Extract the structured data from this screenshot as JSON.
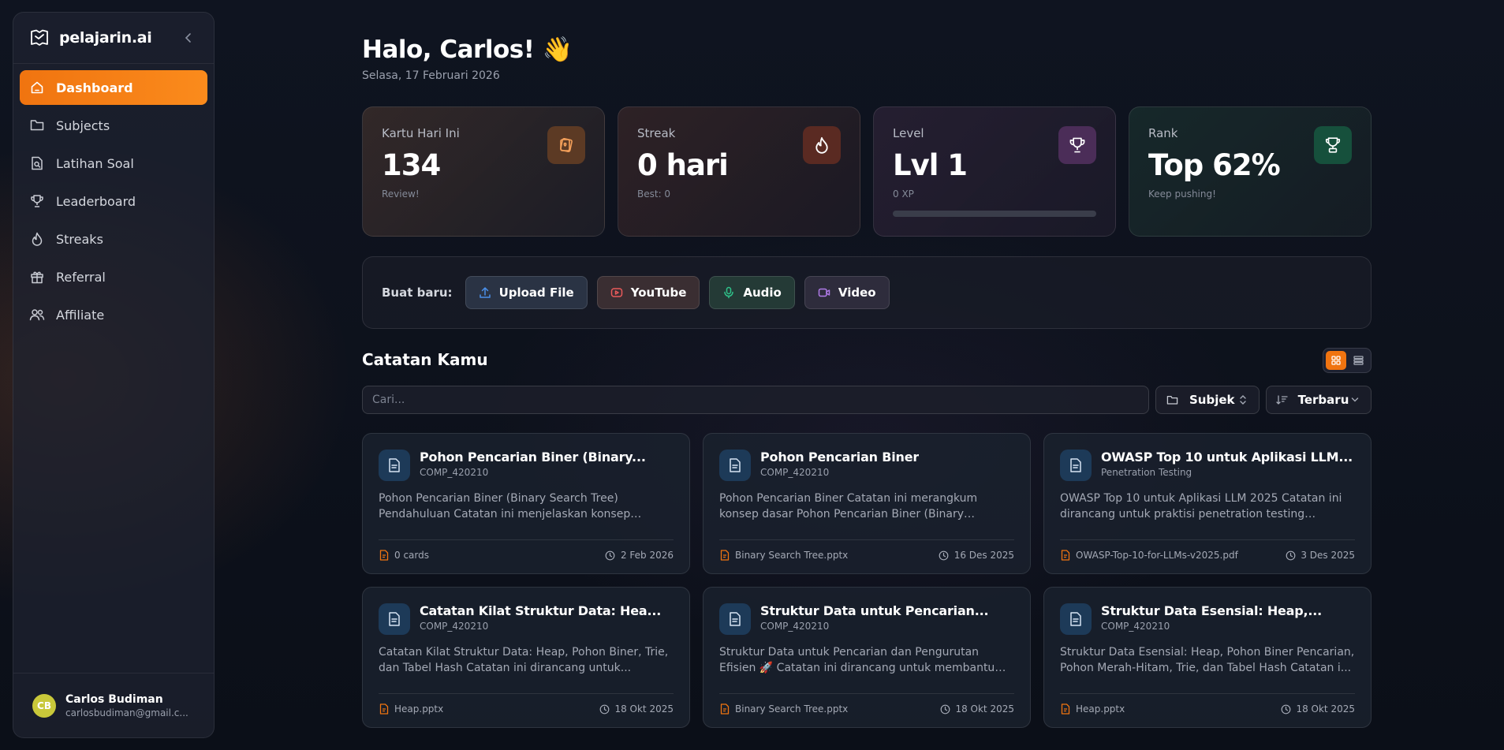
{
  "app": {
    "name": "pelajarin.ai",
    "logo_icon": "book-logo-icon"
  },
  "sidebar": {
    "items": [
      {
        "label": "Dashboard",
        "icon": "home-icon",
        "active": true
      },
      {
        "label": "Subjects",
        "icon": "folder-icon"
      },
      {
        "label": "Latihan Soal",
        "icon": "file-search-icon"
      },
      {
        "label": "Leaderboard",
        "icon": "trophy-icon"
      },
      {
        "label": "Streaks",
        "icon": "flame-icon"
      },
      {
        "label": "Referral",
        "icon": "gift-icon"
      },
      {
        "label": "Affiliate",
        "icon": "users-icon"
      }
    ],
    "user": {
      "initials": "CB",
      "name": "Carlos Budiman",
      "email": "carlosbudiman@gmail.c..."
    }
  },
  "header": {
    "greeting": "Halo, Carlos! 👋",
    "date": "Selasa, 17 Februari 2026"
  },
  "stats": [
    {
      "label": "Kartu Hari Ini",
      "value": "134",
      "sub": "Review!",
      "icon": "cards-icon"
    },
    {
      "label": "Streak",
      "value": "0 hari",
      "sub": "Best: 0",
      "icon": "flame-icon"
    },
    {
      "label": "Level",
      "value": "Lvl 1",
      "sub": "0 XP",
      "icon": "trophy-icon",
      "progress": 0
    },
    {
      "label": "Rank",
      "value": "Top 62%",
      "sub": "Keep pushing!",
      "icon": "award-icon"
    }
  ],
  "create": {
    "label": "Buat baru:",
    "buttons": [
      {
        "label": "Upload File",
        "icon": "upload-icon",
        "color": "#4a8fe8"
      },
      {
        "label": "YouTube",
        "icon": "youtube-icon",
        "color": "#e85a5a"
      },
      {
        "label": "Audio",
        "icon": "mic-icon",
        "color": "#2fc28a"
      },
      {
        "label": "Video",
        "icon": "video-icon",
        "color": "#b07ae8"
      }
    ]
  },
  "notes": {
    "title": "Catatan Kamu",
    "search_placeholder": "Cari...",
    "filter_subject": "Subjek",
    "sort": "Terbaru",
    "accent": "#f07410",
    "cards": [
      {
        "title": "Pohon Pencarian Biner (Binary...",
        "subject": "COMP_420210",
        "desc": "Pohon Pencarian Biner (Binary Search Tree) Pendahuluan Catatan ini menjelaskan konsep dasar...",
        "file": "0 cards",
        "date": "2 Feb 2026"
      },
      {
        "title": "Pohon Pencarian Biner",
        "subject": "COMP_420210",
        "desc": "Pohon Pencarian Biner Catatan ini merangkum konsep dasar Pohon Pencarian Biner (Binary Search...",
        "file": "Binary Search Tree.pptx",
        "date": "16 Des 2025"
      },
      {
        "title": "OWASP Top 10 untuk Aplikasi LLM...",
        "subject": "Penetration Testing",
        "desc": "OWASP Top 10 untuk Aplikasi LLM 2025 Catatan ini dirancang untuk praktisi penetration testing tingkat...",
        "file": "OWASP-Top-10-for-LLMs-v2025.pdf",
        "date": "3 Des 2025"
      },
      {
        "title": "Catatan Kilat Struktur Data: Hea...",
        "subject": "COMP_420210",
        "desc": "Catatan Kilat Struktur Data: Heap, Pohon Biner, Trie, dan Tabel Hash Catatan ini dirancang untuk...",
        "file": "Heap.pptx",
        "date": "18 Okt 2025"
      },
      {
        "title": "Struktur Data untuk Pencarian...",
        "subject": "COMP_420210",
        "desc": "Struktur Data untuk Pencarian dan Pengurutan Efisien 🚀 Catatan ini dirancang untuk membantu Anda...",
        "file": "Binary Search Tree.pptx",
        "date": "18 Okt 2025"
      },
      {
        "title": "Struktur Data Esensial: Heap,...",
        "subject": "COMP_420210",
        "desc": "Struktur Data Esensial: Heap, Pohon Biner Pencarian, Pohon Merah-Hitam, Trie, dan Tabel Hash Catatan i...",
        "file": "Heap.pptx",
        "date": "18 Okt 2025"
      }
    ]
  }
}
